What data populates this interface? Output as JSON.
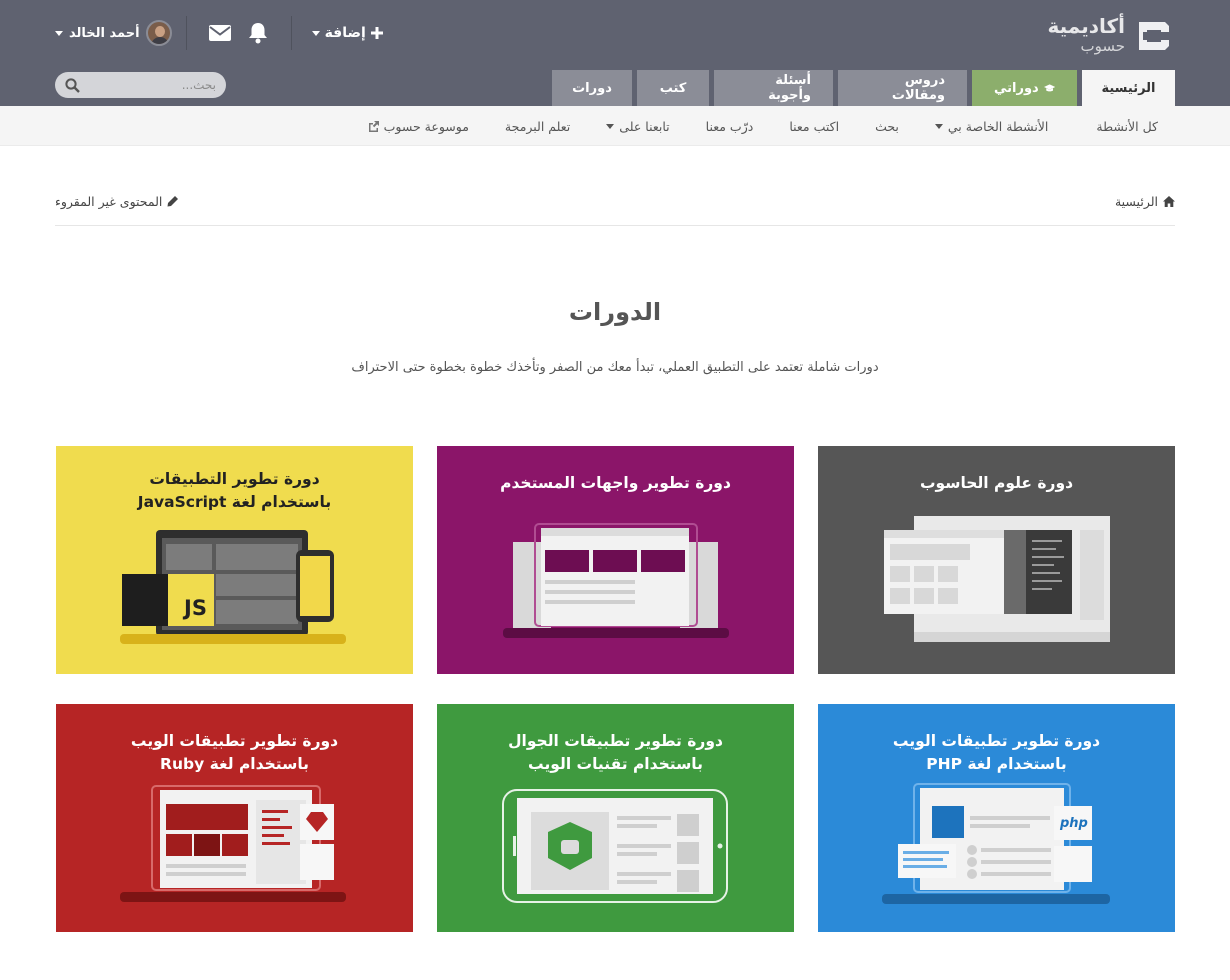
{
  "logo": {
    "line1": "أكاديمية",
    "line2": "حسوب"
  },
  "tabs": [
    {
      "label": "الرئيسية"
    },
    {
      "label": "دوراتي"
    },
    {
      "label": "دروس ومقالات"
    },
    {
      "label": "أسئلة وأجوبة"
    },
    {
      "label": "كتب"
    },
    {
      "label": "دورات"
    }
  ],
  "user": {
    "name": "أحمد الخالد",
    "add_label": "إضافة"
  },
  "search": {
    "placeholder": "بحث..."
  },
  "subnav": [
    {
      "label": "كل الأنشطة"
    },
    {
      "label": "الأنشطة الخاصة بي"
    },
    {
      "label": "بحث"
    },
    {
      "label": "اكتب معنا"
    },
    {
      "label": "درّب معنا"
    },
    {
      "label": "تابعنا على"
    },
    {
      "label": "تعلم البرمجة"
    },
    {
      "label": "موسوعة حسوب"
    }
  ],
  "breadcrumb": {
    "home": "الرئيسية"
  },
  "unread_label": "المحتوى غير المقروء",
  "page": {
    "title": "الدورات",
    "description": "دورات شاملة تعتمد على التطبيق العملي، تبدأ معك من الصفر وتأخذك خطوة بخطوة حتى الاحتراف"
  },
  "courses": [
    {
      "line1": "دورة علوم الحاسوب",
      "line2": "",
      "color": "#565656"
    },
    {
      "line1": "دورة تطوير واجهات المستخدم",
      "line2": "",
      "color": "#8b1569"
    },
    {
      "line1": "دورة تطوير التطبيقات",
      "line2": "باستخدام لغة JavaScript",
      "color": "#f0dc4e"
    },
    {
      "line1": "دورة تطوير تطبيقات الويب",
      "line2": "باستخدام لغة PHP",
      "color": "#2b8ad8"
    },
    {
      "line1": "دورة تطوير تطبيقات الجوال",
      "line2": "باستخدام تقنيات الويب",
      "color": "#3f9a3f"
    },
    {
      "line1": "دورة تطوير تطبيقات الويب",
      "line2": "باستخدام لغة Ruby",
      "color": "#b62525"
    }
  ]
}
